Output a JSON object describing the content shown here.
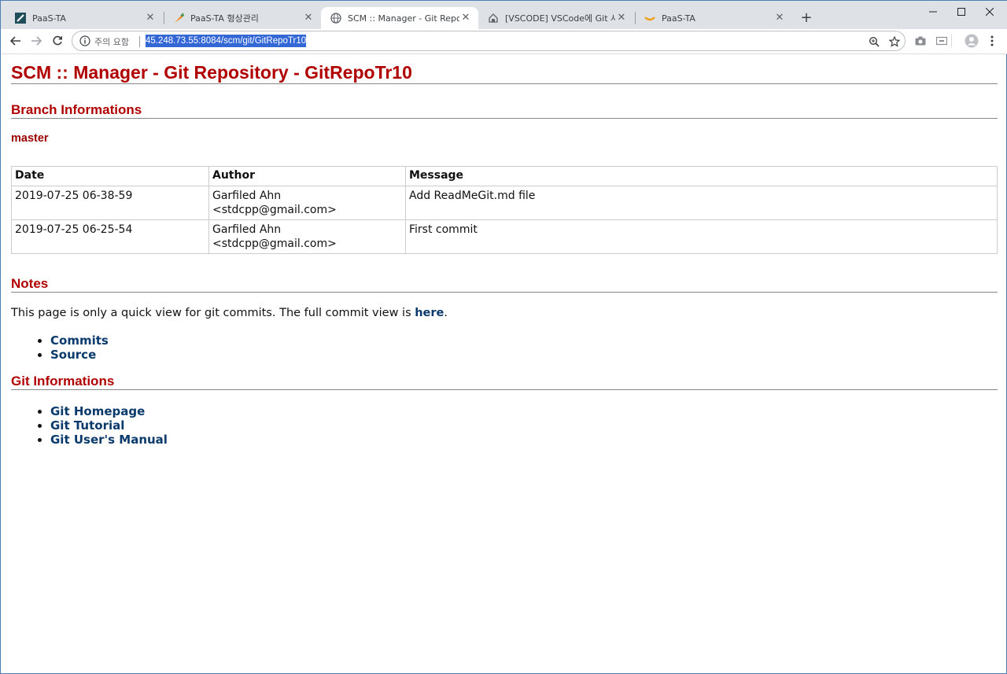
{
  "browser": {
    "tabs": [
      {
        "title": "PaaS-TA",
        "active": false
      },
      {
        "title": "PaaS-TA 형상관리",
        "active": false
      },
      {
        "title": "SCM :: Manager - Git Repositor",
        "active": true
      },
      {
        "title": "[VSCODE] VSCode에 Git 사용하",
        "active": false
      },
      {
        "title": "PaaS-TA",
        "active": false
      }
    ],
    "new_tab": "+",
    "omnibox": {
      "security_label": "주의 요함",
      "url": "45.248.73.55:8084/scm/git/GitRepoTr10"
    }
  },
  "page": {
    "title": "SCM :: Manager - Git Repository - GitRepoTr10",
    "branch_heading": "Branch Informations",
    "branch_name": "master",
    "table": {
      "headers": [
        "Date",
        "Author",
        "Message"
      ],
      "rows": [
        {
          "date": "2019-07-25 06-38-59",
          "author_name": "Garfiled Ahn",
          "author_email": "<stdcpp@gmail.com>",
          "message": "Add ReadMeGit.md file"
        },
        {
          "date": "2019-07-25 06-25-54",
          "author_name": "Garfiled Ahn",
          "author_email": "<stdcpp@gmail.com>",
          "message": "First commit"
        }
      ]
    },
    "notes_heading": "Notes",
    "notes_text": "This page is only a quick view for git commits. The full commit view is",
    "notes_link": "here",
    "notes_period": ".",
    "notes_links": [
      "Commits",
      "Source"
    ],
    "git_heading": "Git Informations",
    "git_links": [
      "Git Homepage",
      "Git Tutorial",
      "Git User's Manual"
    ]
  },
  "colors": {
    "heading": "#b00000",
    "link": "#0a3a6b",
    "url_selection": "#3367d6"
  }
}
